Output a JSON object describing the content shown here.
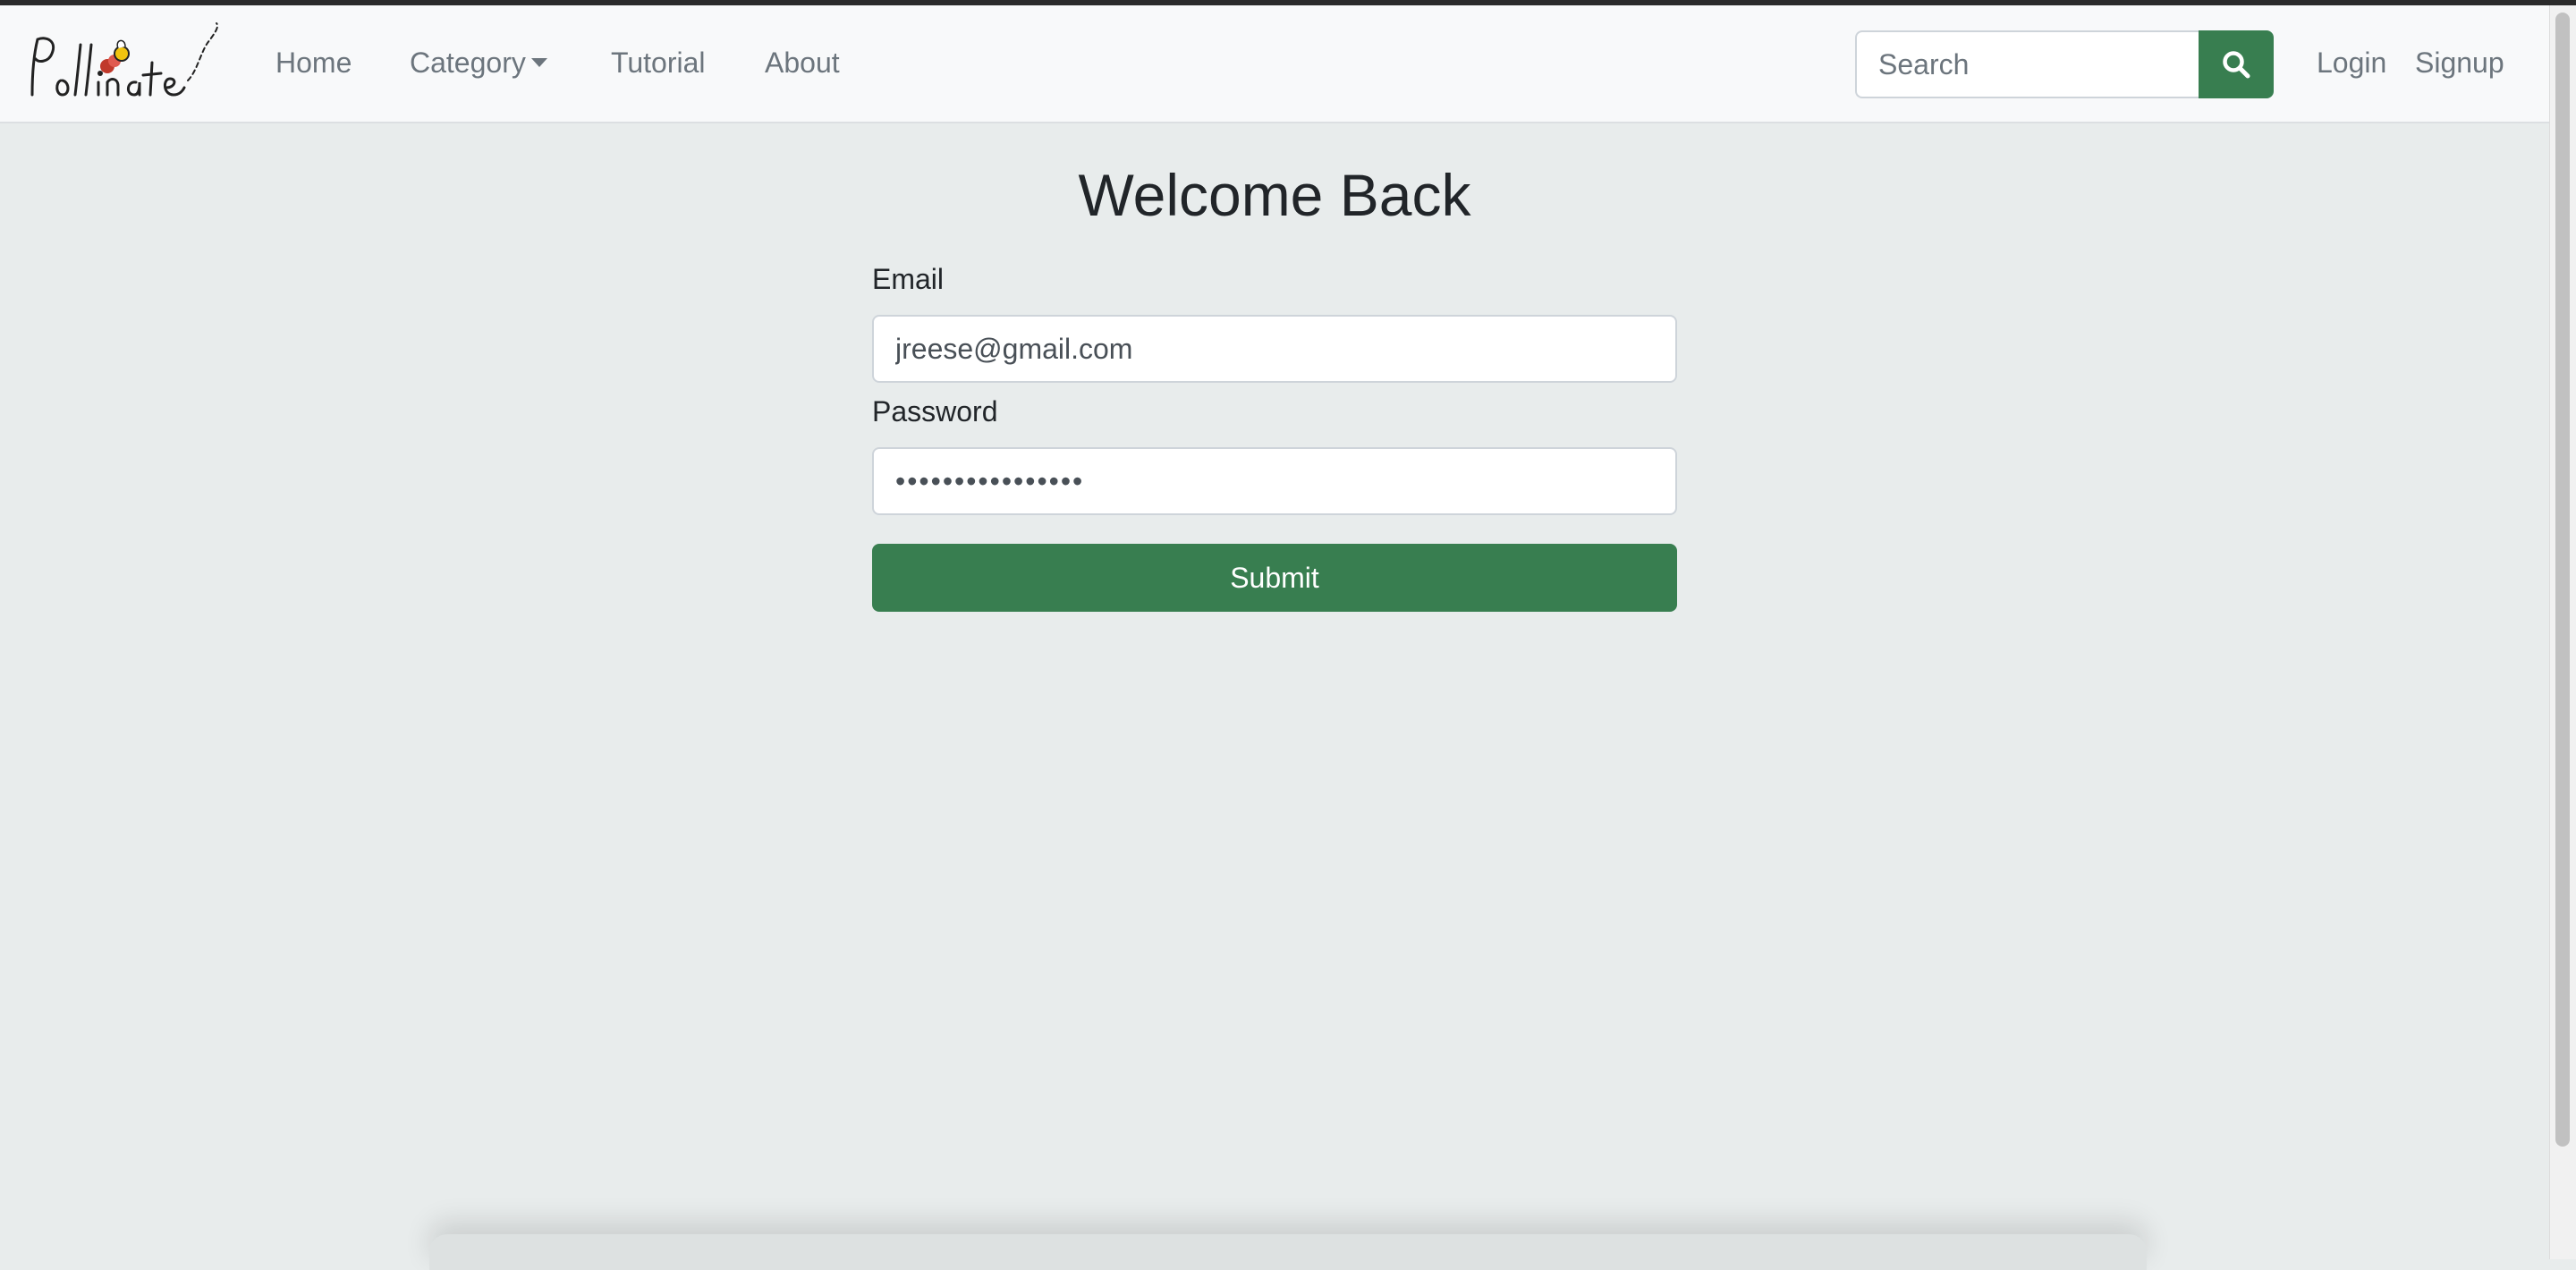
{
  "navbar": {
    "logo_text": "Pollinate",
    "links": {
      "home": "Home",
      "category": "Category",
      "tutorial": "Tutorial",
      "about": "About",
      "login": "Login",
      "signup": "Signup"
    },
    "search": {
      "placeholder": "Search",
      "icon": "search-icon"
    }
  },
  "form": {
    "title": "Welcome Back",
    "email_label": "Email",
    "email_value": "jreese@gmail.com",
    "password_label": "Password",
    "password_value": "••••••••••••••••",
    "submit_label": "Submit"
  },
  "colors": {
    "accent": "#387e50",
    "page_background": "#e8ecec",
    "navbar_background": "#f8f9fa"
  }
}
